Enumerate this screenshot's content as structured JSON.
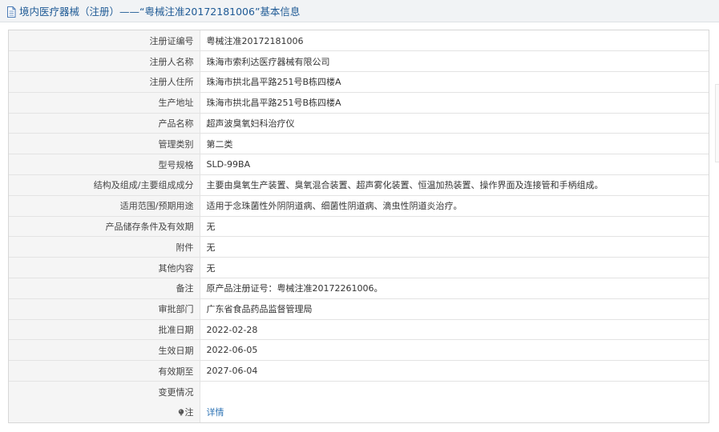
{
  "header": {
    "title": "境内医疗器械（注册）——“粤械注准20172181006”基本信息"
  },
  "rows": [
    {
      "label": "注册证编号",
      "value": "粤械注准20172181006"
    },
    {
      "label": "注册人名称",
      "value": "珠海市索利达医疗器械有限公司"
    },
    {
      "label": "注册人住所",
      "value": "珠海市拱北昌平路251号B栋四楼A"
    },
    {
      "label": "生产地址",
      "value": "珠海市拱北昌平路251号B栋四楼A"
    },
    {
      "label": "产品名称",
      "value": "超声波臭氧妇科治疗仪"
    },
    {
      "label": "管理类别",
      "value": "第二类"
    },
    {
      "label": "型号规格",
      "value": "SLD-99BA"
    },
    {
      "label": "结构及组成/主要组成成分",
      "value": "主要由臭氧生产装置、臭氧混合装置、超声雾化装置、恒温加热装置、操作界面及连接管和手柄组成。"
    },
    {
      "label": "适用范围/预期用途",
      "value": "适用于念珠菌性外阴阴道病、细菌性阴道病、滴虫性阴道炎治疗。"
    },
    {
      "label": "产品储存条件及有效期",
      "value": "无"
    },
    {
      "label": "附件",
      "value": "无"
    },
    {
      "label": "其他内容",
      "value": "无"
    },
    {
      "label": "备注",
      "value": "原产品注册证号：粤械注准20172261006。"
    },
    {
      "label": "审批部门",
      "value": "广东省食品药品监督管理局"
    },
    {
      "label": "批准日期",
      "value": "2022-02-28"
    },
    {
      "label": "生效日期",
      "value": "2022-06-05"
    },
    {
      "label": "有效期至",
      "value": "2027-06-04"
    },
    {
      "label": "变更情况",
      "value": ""
    }
  ],
  "note_row": {
    "label": "注",
    "link_text": "详情",
    "icon": "info-bulb-icon"
  }
}
